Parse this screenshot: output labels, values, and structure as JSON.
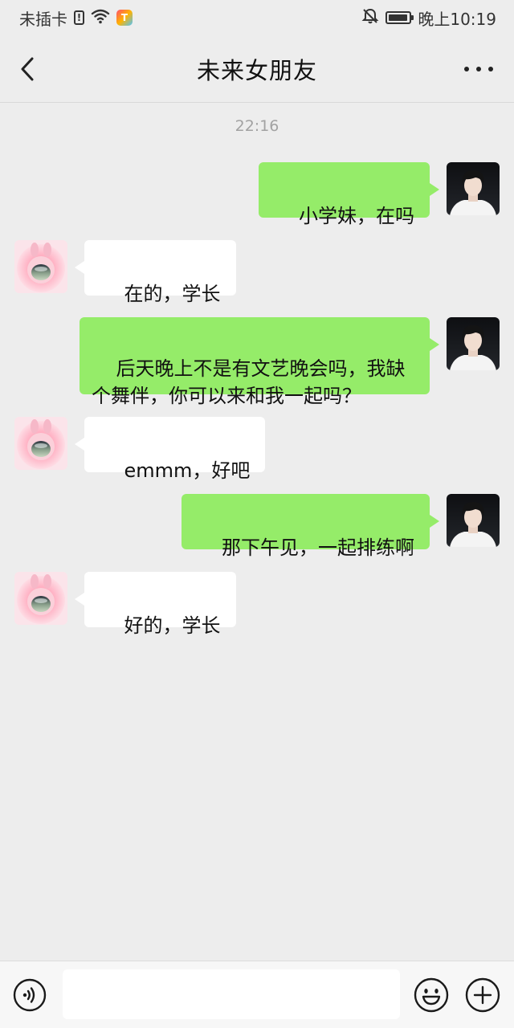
{
  "status_bar": {
    "carrier": "未插卡",
    "sim_alert": "!",
    "app_badge": "T",
    "time": "晚上10:19",
    "icons": [
      "sim-alert-icon",
      "wifi-icon",
      "app-badge-icon",
      "mute-bell-icon",
      "battery-icon"
    ],
    "battery_level": 0.95
  },
  "header": {
    "title": "未来女朋友",
    "back_icon": "chevron-left-icon",
    "more_icon": "more-dots-icon"
  },
  "chat": {
    "timestamp": "22:16",
    "messages": [
      {
        "from": "me",
        "text": "小学妹，在吗"
      },
      {
        "from": "her",
        "text": "在的，学长"
      },
      {
        "from": "me",
        "text": "后天晚上不是有文艺晚会吗，我缺\n个舞伴，你可以来和我一起吗？"
      },
      {
        "from": "her",
        "text": "emmm，好吧"
      },
      {
        "from": "me",
        "text": "那下午见，一起排练啊"
      },
      {
        "from": "her",
        "text": "好的，学长"
      }
    ]
  },
  "input_bar": {
    "value": "",
    "icons": [
      "voice-icon",
      "emoji-icon",
      "plus-icon"
    ]
  },
  "colors": {
    "background": "#ededed",
    "my_bubble": "#95ec69",
    "her_bubble": "#ffffff",
    "input_bar": "#f7f7f7",
    "timestamp": "#a2a2a2"
  }
}
